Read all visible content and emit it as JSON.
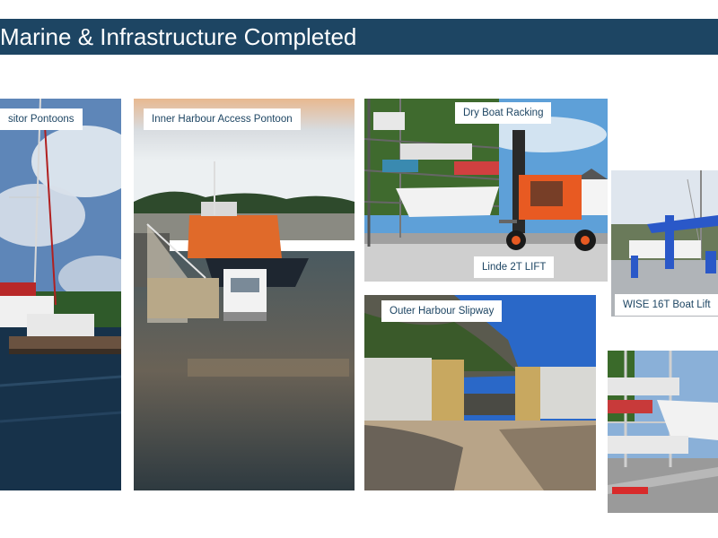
{
  "slide": {
    "title": "Marine & Infrastructure Completed",
    "colors": {
      "title_bar": "#1d4563",
      "title_text": "#ffffff",
      "caption_text": "#1d4563",
      "caption_bg": "#ffffff"
    }
  },
  "photos": [
    {
      "id": "visitor-pontoons",
      "caption": "sitor Pontoons"
    },
    {
      "id": "inner-harbour",
      "caption": "Inner Harbour Access Pontoon"
    },
    {
      "id": "dry-boat-racking",
      "caption": "Dry Boat Racking",
      "second_caption": "Linde 2T LIFT"
    },
    {
      "id": "wise-lift",
      "caption": "WISE 16T Boat Lift"
    },
    {
      "id": "outer-slipway",
      "caption": "Outer Harbour Slipway"
    },
    {
      "id": "boat-trailer",
      "caption": ""
    }
  ]
}
